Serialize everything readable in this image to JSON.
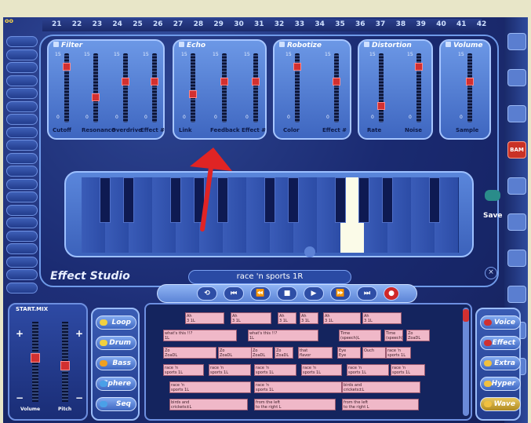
{
  "ruler": {
    "ticks": [
      "21",
      "22",
      "23",
      "24",
      "25",
      "26",
      "27",
      "28",
      "29",
      "30",
      "31",
      "32",
      "33",
      "34",
      "35",
      "36",
      "37",
      "38",
      "39",
      "40",
      "41",
      "42"
    ]
  },
  "effect_panel": {
    "title": "Effect Studio",
    "filter": {
      "title": "Filter",
      "labels": [
        "Cutoff",
        "Resonance",
        "Overdrive",
        "Effect #"
      ],
      "levels": [
        0.85,
        0.35,
        0.6,
        0.6
      ]
    },
    "echo": {
      "title": "Echo",
      "labels": [
        "Link",
        "Feedback",
        "Effect #"
      ],
      "levels": [
        0.4,
        0.6,
        0.6
      ]
    },
    "robotize": {
      "title": "Robotize",
      "labels": [
        "Color",
        "Effect #"
      ],
      "levels": [
        0.85,
        0.6
      ]
    },
    "distortion": {
      "title": "Distortion",
      "labels": [
        "Rate",
        "Noise"
      ],
      "levels": [
        0.2,
        0.85
      ]
    },
    "volume": {
      "title": "Volume",
      "labels": [
        "Sample"
      ],
      "levels": [
        0.6
      ]
    },
    "slider_max": "15",
    "slider_min": "0"
  },
  "display_text": "race 'n sports 1R",
  "save_label": "Save",
  "close_label": "×",
  "right_toolbar": {
    "top_label": "oo",
    "tool_label": "BAM"
  },
  "transport": {
    "buttons": [
      "⟲",
      "⏮",
      "⏪",
      "■",
      "▶",
      "⏩",
      "⏭",
      "●"
    ]
  },
  "mixer": {
    "title": "START.MIX",
    "volume_label": "Volume",
    "pitch_label": "Pitch",
    "volume_level": 0.55,
    "pitch_level": 0.45,
    "plus": "+",
    "minus": "−"
  },
  "left_categories": [
    {
      "label": "Loop",
      "led": "#f0d040"
    },
    {
      "label": "Drum",
      "led": "#f0d040"
    },
    {
      "label": "Bass",
      "led": "#f0a020"
    },
    {
      "label": "Sphere",
      "led": "#4aa0e8"
    },
    {
      "label": "Seq",
      "led": "#4aa0e8"
    }
  ],
  "right_categories": [
    {
      "label": "Voice",
      "led": "#d03030"
    },
    {
      "label": "Effect",
      "led": "#d03030"
    },
    {
      "label": "Extra",
      "led": "#f0c040"
    },
    {
      "label": "Hyper",
      "led": "#f0c040"
    },
    {
      "label": "Wave",
      "led": "#f0c040"
    }
  ],
  "sequencer_rows": [
    [
      {
        "t": "Ah\n3 1L"
      },
      {
        "t": "Ah\n3 1L"
      },
      {
        "t": "Ah\n3 1L"
      },
      {
        "t": "Ah\n3 1L"
      },
      {
        "t": "Ah\n3 1L"
      },
      {
        "t": "Ah\n3 1L"
      }
    ],
    [
      {
        "t": "what's this !!?\n1L"
      },
      {
        "t": "what's this !!?\n1L"
      },
      {
        "t": "Time\n(speech)L"
      },
      {
        "t": "Time\n(speech)L"
      },
      {
        "t": "Zo\nZoaDL"
      },
      {
        "t": "Zo\nZoaDL"
      }
    ],
    [
      {
        "t": "Zo\nZoaDL"
      },
      {
        "t": "Zo\nZoaDL"
      },
      {
        "t": "Zo\nZoaDL"
      },
      {
        "t": "Zo\nZoaDL"
      },
      {
        "t": "that\nflavor"
      },
      {
        "t": "Eye\nEye"
      },
      {
        "t": "Ouch"
      },
      {
        "t": "race 'n\nsports 1L"
      }
    ],
    [
      {
        "t": "race 'n\nsports 1L"
      },
      {
        "t": "race 'n\nsports 1L"
      },
      {
        "t": "race 'n\nsports 1L"
      },
      {
        "t": "race 'n\nsports 1L"
      },
      {
        "t": "race 'n\nsports 1L"
      },
      {
        "t": "race 'n\nsports 1L"
      }
    ],
    [
      {
        "t": "race 'n\nsports 1L"
      },
      {
        "t": "race 'n\nsports 1L"
      },
      {
        "t": "birds and\ncrickets±L"
      }
    ],
    [
      {
        "t": "birds and\ncrickets±L"
      },
      {
        "t": "from the left\nto the right L"
      },
      {
        "t": "from the left\nto the right L"
      }
    ]
  ]
}
